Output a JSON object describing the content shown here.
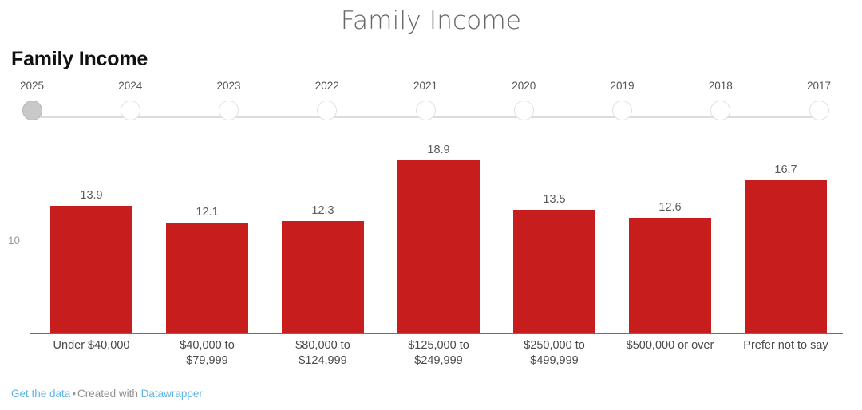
{
  "page": {
    "title": "Family Income"
  },
  "chart": {
    "headline": "Family Income",
    "bar_color": "#c81d1d",
    "gridline_label": "10"
  },
  "timeline": {
    "selected_year": "2025",
    "years": [
      "2025",
      "2024",
      "2023",
      "2022",
      "2021",
      "2020",
      "2019",
      "2018",
      "2017"
    ]
  },
  "footer": {
    "get_data_label": "Get the data",
    "separator": "•",
    "created_with_label": "Created with",
    "brand_label": "Datawrapper"
  },
  "chart_data": {
    "type": "bar",
    "title": "Family Income",
    "xlabel": "",
    "ylabel": "",
    "ylim": [
      0,
      19.5
    ],
    "grid": true,
    "gridlines": [
      10
    ],
    "legend": "none",
    "value_labels": true,
    "categories": [
      "Under $40,000",
      "$40,000 to $79,999",
      "$80,000 to $124,999",
      "$125,000 to $249,999",
      "$250,000 to $499,999",
      "$500,000 or over",
      "Prefer not to say"
    ],
    "category_lines": [
      [
        "Under $40,000"
      ],
      [
        "$40,000 to",
        "$79,999"
      ],
      [
        "$80,000 to",
        "$124,999"
      ],
      [
        "$125,000 to",
        "$249,999"
      ],
      [
        "$250,000 to",
        "$499,999"
      ],
      [
        "$500,000 or over"
      ],
      [
        "Prefer not to say"
      ]
    ],
    "values": [
      13.9,
      12.1,
      12.3,
      18.9,
      13.5,
      12.6,
      16.7
    ],
    "value_text": [
      "13.9",
      "12.1",
      "12.3",
      "18.9",
      "13.5",
      "12.6",
      "16.7"
    ]
  }
}
